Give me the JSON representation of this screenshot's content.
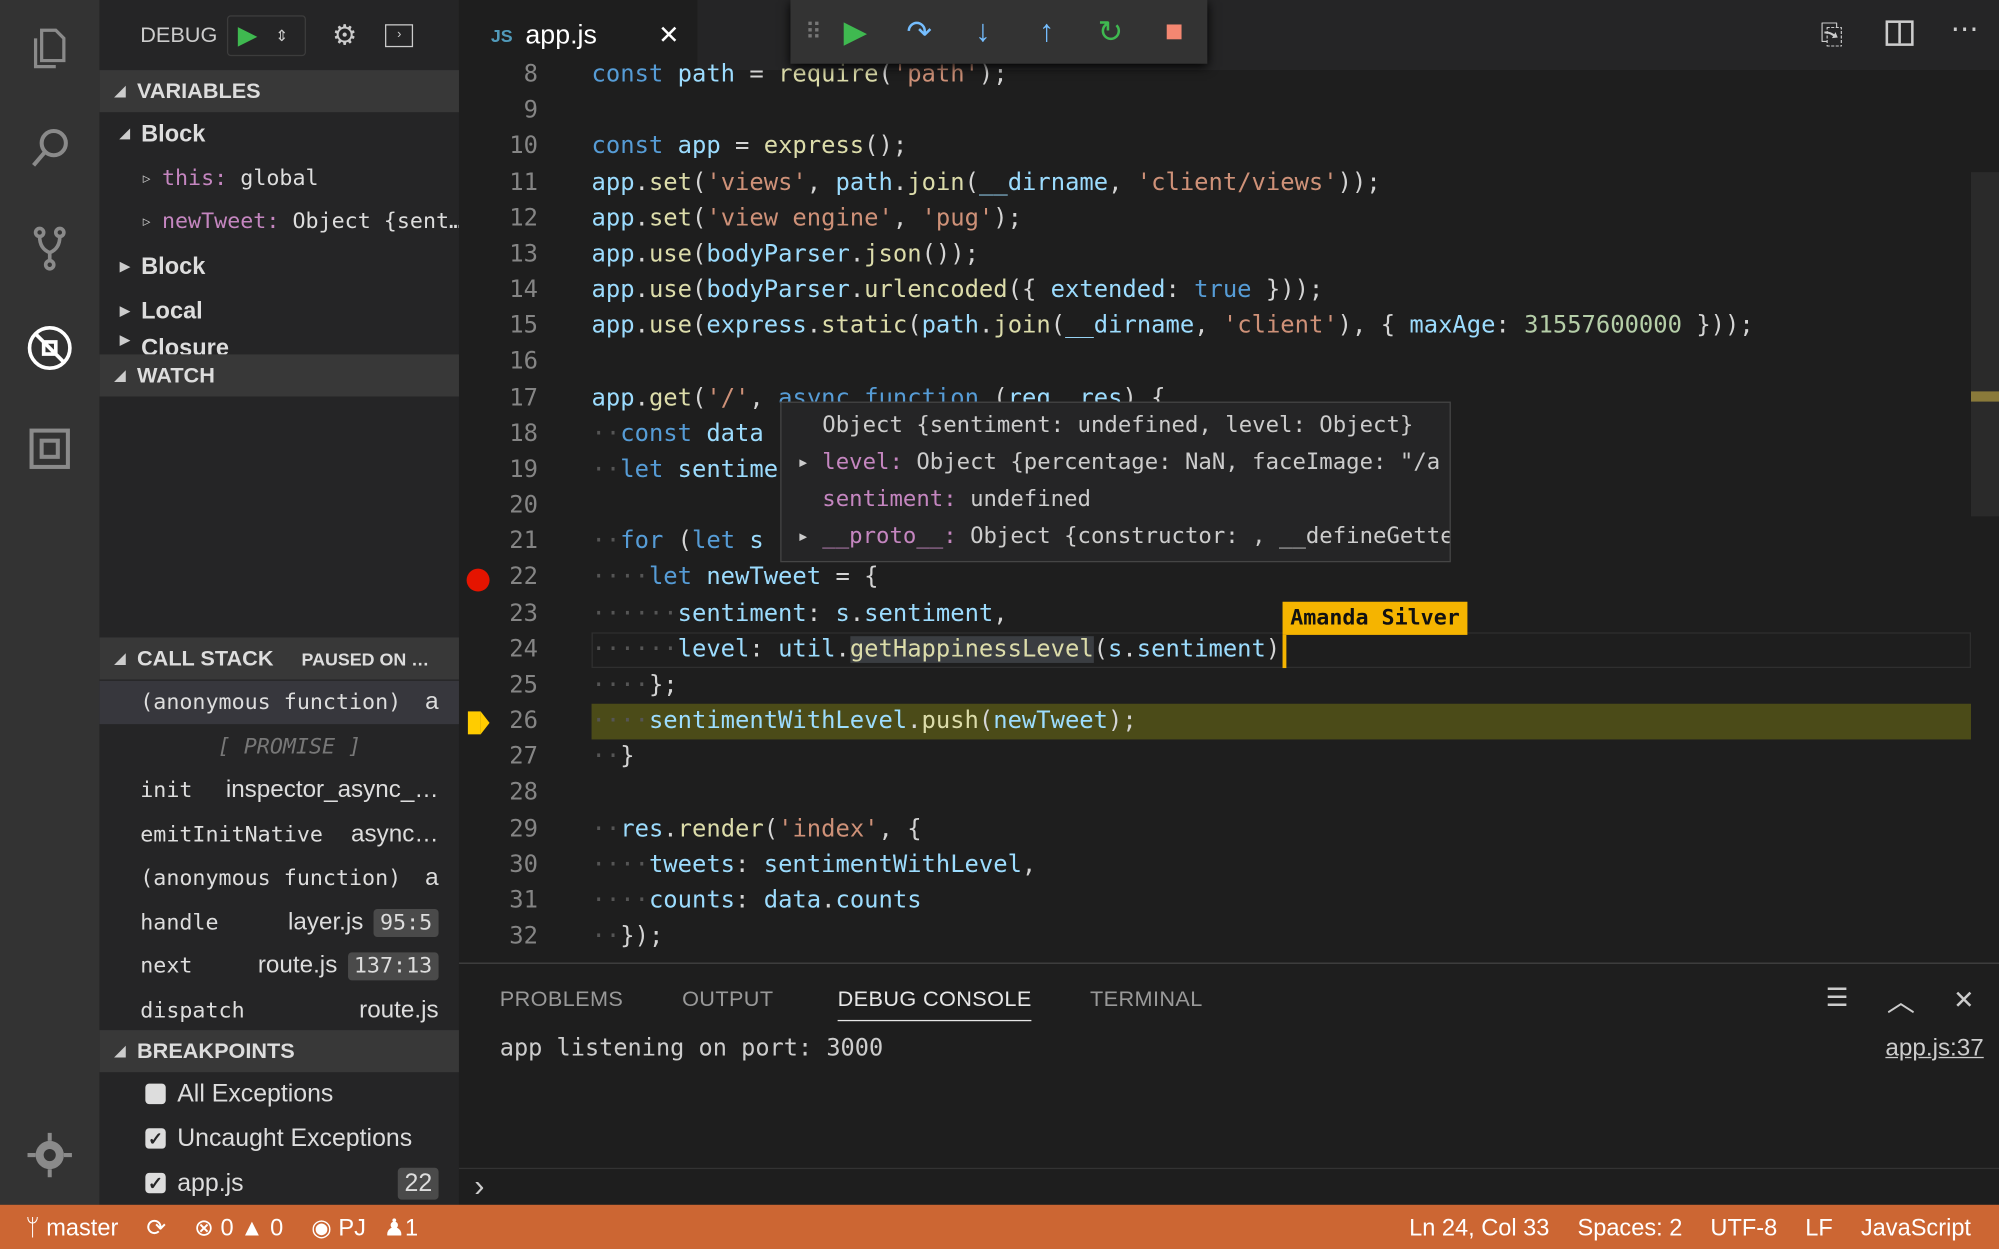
{
  "activity_bar": {
    "icons": [
      "files-icon",
      "search-icon",
      "source-control-icon",
      "debug-icon",
      "extensions-icon"
    ],
    "settings_icon": "gear-icon"
  },
  "debug_header": {
    "title": "DEBUG"
  },
  "sidebar": {
    "variables": {
      "title": "VARIABLES",
      "items": [
        {
          "label": "Block",
          "expanded": true,
          "level": 0
        },
        {
          "key": "this:",
          "value": "global",
          "level": 1
        },
        {
          "key": "newTweet:",
          "value": "Object {sent…",
          "level": 1
        },
        {
          "label": "Block",
          "expanded": false,
          "level": 0
        },
        {
          "label": "Local",
          "expanded": false,
          "level": 0
        },
        {
          "label": "Closure",
          "expanded": false,
          "level": 0
        }
      ]
    },
    "watch": {
      "title": "WATCH"
    },
    "call_stack": {
      "title": "CALL STACK",
      "status": "PAUSED ON …",
      "frames": [
        {
          "name": "(anonymous function)",
          "file": "a",
          "selected": true
        },
        {
          "name": "[ PROMISE ]",
          "separator": true
        },
        {
          "name": "init",
          "file": "inspector_async_…"
        },
        {
          "name": "emitInitNative",
          "file": "async…"
        },
        {
          "name": "(anonymous function)",
          "file": "a"
        },
        {
          "name": "handle",
          "file": "layer.js",
          "pos": "95:5"
        },
        {
          "name": "next",
          "file": "route.js",
          "pos": "137:13"
        },
        {
          "name": "dispatch",
          "file": "route.js"
        }
      ]
    },
    "breakpoints": {
      "title": "BREAKPOINTS",
      "items": [
        {
          "label": "All Exceptions",
          "checked": false
        },
        {
          "label": "Uncaught Exceptions",
          "checked": true
        },
        {
          "label": "app.js",
          "checked": true,
          "line": "22"
        }
      ]
    }
  },
  "tab": {
    "icon": "JS",
    "label": "app.js"
  },
  "debug_toolbar": [
    "drag-handle",
    "continue",
    "step-over",
    "step-into",
    "step-out",
    "restart",
    "stop"
  ],
  "editor": {
    "breakpoint_line": 22,
    "current_line": 26,
    "lines": [
      {
        "n": "8",
        "t": [
          [
            "kw",
            "const "
          ],
          [
            "vr",
            "path"
          ],
          [
            "pl",
            " = "
          ],
          [
            "fn",
            "require"
          ],
          [
            "pl",
            "("
          ],
          [
            "st",
            "'path'"
          ],
          [
            "pl",
            ");"
          ]
        ]
      },
      {
        "n": "9",
        "t": []
      },
      {
        "n": "10",
        "t": [
          [
            "kw",
            "const "
          ],
          [
            "vr",
            "app"
          ],
          [
            "pl",
            " = "
          ],
          [
            "fn",
            "express"
          ],
          [
            "pl",
            "();"
          ]
        ]
      },
      {
        "n": "11",
        "t": [
          [
            "vr",
            "app"
          ],
          [
            "pl",
            "."
          ],
          [
            "fn",
            "set"
          ],
          [
            "pl",
            "("
          ],
          [
            "st",
            "'views'"
          ],
          [
            "pl",
            ", "
          ],
          [
            "vr",
            "path"
          ],
          [
            "pl",
            "."
          ],
          [
            "fn",
            "join"
          ],
          [
            "pl",
            "("
          ],
          [
            "vr",
            "__dirname"
          ],
          [
            "pl",
            ", "
          ],
          [
            "st",
            "'client/views'"
          ],
          [
            "pl",
            "));"
          ]
        ]
      },
      {
        "n": "12",
        "t": [
          [
            "vr",
            "app"
          ],
          [
            "pl",
            "."
          ],
          [
            "fn",
            "set"
          ],
          [
            "pl",
            "("
          ],
          [
            "st",
            "'view engine'"
          ],
          [
            "pl",
            ", "
          ],
          [
            "st",
            "'pug'"
          ],
          [
            "pl",
            ");"
          ]
        ]
      },
      {
        "n": "13",
        "t": [
          [
            "vr",
            "app"
          ],
          [
            "pl",
            "."
          ],
          [
            "fn",
            "use"
          ],
          [
            "pl",
            "("
          ],
          [
            "vr",
            "bodyParser"
          ],
          [
            "pl",
            "."
          ],
          [
            "fn",
            "json"
          ],
          [
            "pl",
            "());"
          ]
        ]
      },
      {
        "n": "14",
        "t": [
          [
            "vr",
            "app"
          ],
          [
            "pl",
            "."
          ],
          [
            "fn",
            "use"
          ],
          [
            "pl",
            "("
          ],
          [
            "vr",
            "bodyParser"
          ],
          [
            "pl",
            "."
          ],
          [
            "fn",
            "urlencoded"
          ],
          [
            "pl",
            "({ "
          ],
          [
            "vr",
            "extended"
          ],
          [
            "pl",
            ": "
          ],
          [
            "kw",
            "true"
          ],
          [
            "pl",
            " }));"
          ]
        ]
      },
      {
        "n": "15",
        "t": [
          [
            "vr",
            "app"
          ],
          [
            "pl",
            "."
          ],
          [
            "fn",
            "use"
          ],
          [
            "pl",
            "("
          ],
          [
            "vr",
            "express"
          ],
          [
            "pl",
            "."
          ],
          [
            "fn",
            "static"
          ],
          [
            "pl",
            "("
          ],
          [
            "vr",
            "path"
          ],
          [
            "pl",
            "."
          ],
          [
            "fn",
            "join"
          ],
          [
            "pl",
            "("
          ],
          [
            "vr",
            "__dirname"
          ],
          [
            "pl",
            ", "
          ],
          [
            "st",
            "'client'"
          ],
          [
            "pl",
            "), { "
          ],
          [
            "vr",
            "maxAge"
          ],
          [
            "pl",
            ": "
          ],
          [
            "nu",
            "31557600000"
          ],
          [
            "pl",
            " }));"
          ]
        ]
      },
      {
        "n": "16",
        "t": []
      },
      {
        "n": "17",
        "t": [
          [
            "vr",
            "app"
          ],
          [
            "pl",
            "."
          ],
          [
            "fn",
            "get"
          ],
          [
            "pl",
            "("
          ],
          [
            "st",
            "'/'"
          ],
          [
            "pl",
            ", "
          ],
          [
            "kw",
            "async "
          ],
          [
            "kw",
            "function "
          ],
          [
            "pl",
            "("
          ],
          [
            "vr",
            "req"
          ],
          [
            "pl",
            ", "
          ],
          [
            "vr",
            "res"
          ],
          [
            "pl",
            ") {"
          ]
        ]
      },
      {
        "n": "18",
        "t": [
          [
            "ws",
            "··"
          ],
          [
            "kw",
            "const "
          ],
          [
            "vr",
            "data"
          ]
        ]
      },
      {
        "n": "19",
        "t": [
          [
            "ws",
            "··"
          ],
          [
            "kw",
            "let "
          ],
          [
            "vr",
            "sentime"
          ]
        ]
      },
      {
        "n": "20",
        "t": []
      },
      {
        "n": "21",
        "t": [
          [
            "ws",
            "··"
          ],
          [
            "kw",
            "for "
          ],
          [
            "pl",
            "("
          ],
          [
            "kw",
            "let "
          ],
          [
            "vr",
            "s"
          ]
        ]
      },
      {
        "n": "22",
        "t": [
          [
            "ws",
            "····"
          ],
          [
            "kw",
            "let "
          ],
          [
            "vr",
            "newTweet"
          ],
          [
            "pl",
            " = {"
          ]
        ]
      },
      {
        "n": "23",
        "t": [
          [
            "ws",
            "······"
          ],
          [
            "vr",
            "sentiment"
          ],
          [
            "pl",
            ": "
          ],
          [
            "vr",
            "s"
          ],
          [
            "pl",
            "."
          ],
          [
            "vr",
            "sentiment"
          ],
          [
            "pl",
            ","
          ]
        ]
      },
      {
        "n": "24",
        "t": [
          [
            "ws",
            "······"
          ],
          [
            "vr",
            "level"
          ],
          [
            "pl",
            ": "
          ],
          [
            "vr",
            "util"
          ],
          [
            "pl",
            "."
          ],
          [
            "fn",
            "getHappinessLevel"
          ],
          [
            "pl",
            "("
          ],
          [
            "vr",
            "s"
          ],
          [
            "pl",
            "."
          ],
          [
            "vr",
            "sentiment"
          ],
          [
            "pl",
            ")"
          ]
        ]
      },
      {
        "n": "25",
        "t": [
          [
            "ws",
            "····"
          ],
          [
            "pl",
            "};"
          ]
        ]
      },
      {
        "n": "26",
        "t": [
          [
            "ws",
            "····"
          ],
          [
            "vr",
            "sentimentWithLevel"
          ],
          [
            "pl",
            "."
          ],
          [
            "fn",
            "push"
          ],
          [
            "pl",
            "("
          ],
          [
            "vr",
            "newTweet"
          ],
          [
            "pl",
            ");"
          ]
        ]
      },
      {
        "n": "27",
        "t": [
          [
            "ws",
            "··"
          ],
          [
            "pl",
            "}"
          ]
        ]
      },
      {
        "n": "28",
        "t": []
      },
      {
        "n": "29",
        "t": [
          [
            "ws",
            "··"
          ],
          [
            "vr",
            "res"
          ],
          [
            "pl",
            "."
          ],
          [
            "fn",
            "render"
          ],
          [
            "pl",
            "("
          ],
          [
            "st",
            "'index'"
          ],
          [
            "pl",
            ", {"
          ]
        ]
      },
      {
        "n": "30",
        "t": [
          [
            "ws",
            "····"
          ],
          [
            "vr",
            "tweets"
          ],
          [
            "pl",
            ": "
          ],
          [
            "vr",
            "sentimentWithLevel"
          ],
          [
            "pl",
            ","
          ]
        ]
      },
      {
        "n": "31",
        "t": [
          [
            "ws",
            "····"
          ],
          [
            "vr",
            "counts"
          ],
          [
            "pl",
            ": "
          ],
          [
            "vr",
            "data"
          ],
          [
            "pl",
            "."
          ],
          [
            "vr",
            "counts"
          ]
        ]
      },
      {
        "n": "32",
        "t": [
          [
            "ws",
            "··"
          ],
          [
            "pl",
            "});"
          ]
        ]
      }
    ]
  },
  "hover": {
    "title": "Object {sentiment: undefined, level: Object}",
    "rows": [
      {
        "key": "level:",
        "value": " Object {percentage: NaN, faceImage: \"/a",
        "expandable": true
      },
      {
        "key": "sentiment:",
        "value": " undefined",
        "expandable": false
      },
      {
        "key": "__proto__:",
        "value": " Object {constructor: , __defineGette",
        "expandable": true
      }
    ]
  },
  "collaborator": {
    "name": "Amanda Silver",
    "color": "#f5b400"
  },
  "panel": {
    "tabs": [
      "PROBLEMS",
      "OUTPUT",
      "DEBUG CONSOLE",
      "TERMINAL"
    ],
    "active_tab": "DEBUG CONSOLE",
    "output": "app listening on port: 3000",
    "source_link": "app.js:37",
    "prompt": "›"
  },
  "status_bar": {
    "branch": "master",
    "errors": "0",
    "warnings": "0",
    "live_share": "PJ",
    "participants": "1",
    "position": "Ln 24, Col 33",
    "spaces": "Spaces: 2",
    "encoding": "UTF-8",
    "eol": "LF",
    "language": "JavaScript",
    "color": "#cc6633"
  }
}
